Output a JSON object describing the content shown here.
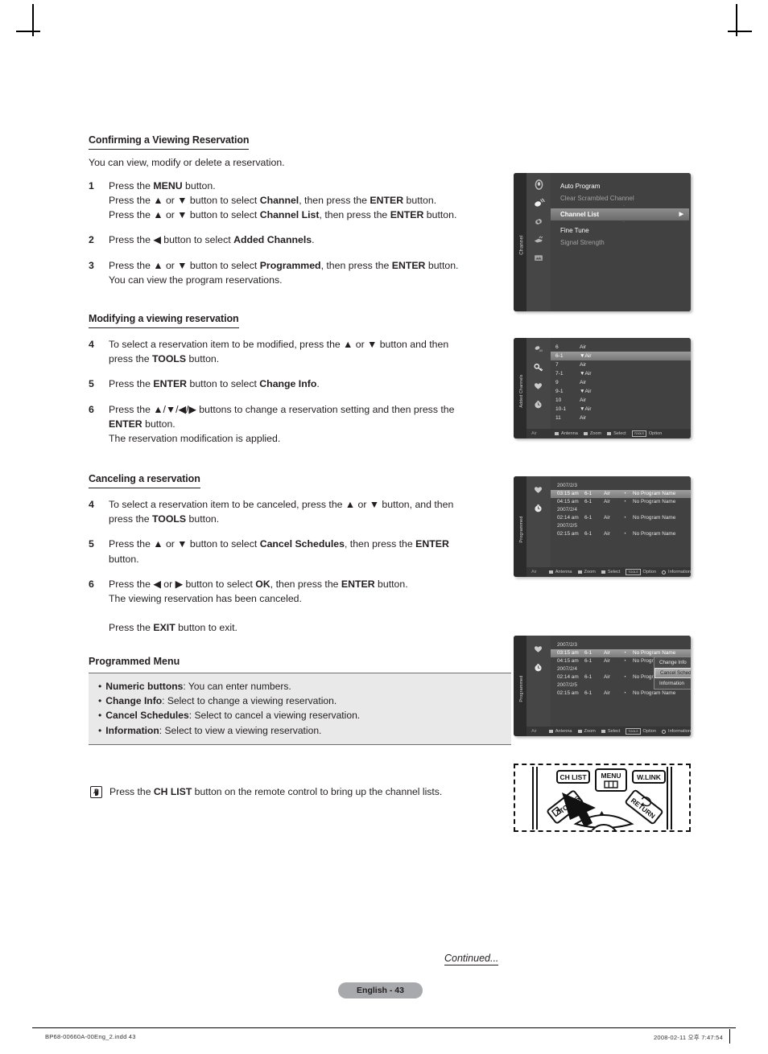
{
  "doc": {
    "page_label": "English - 43",
    "continued": "Continued...",
    "footer_left": "BP68-00660A-00Eng_2.indd   43",
    "footer_right": "2008-02-11   오후 7:47:54"
  },
  "sections": [
    {
      "heading": "Confirming a Viewing Reservation",
      "intro": "You can view, modify or delete a reservation.",
      "steps": [
        {
          "num": "1",
          "lines": [
            [
              {
                "t": "Press the "
              },
              {
                "t": "MENU",
                "b": true
              },
              {
                "t": " button."
              }
            ],
            [
              {
                "t": "Press the ▲ or ▼ button to select "
              },
              {
                "t": "Channel",
                "b": true
              },
              {
                "t": ", then press the "
              },
              {
                "t": "ENTER",
                "b": true
              },
              {
                "t": " button."
              }
            ],
            [
              {
                "t": "Press the ▲ or ▼ button to select "
              },
              {
                "t": "Channel List",
                "b": true
              },
              {
                "t": ", then press the "
              },
              {
                "t": "ENTER",
                "b": true
              },
              {
                "t": " button."
              }
            ]
          ]
        },
        {
          "num": "2",
          "lines": [
            [
              {
                "t": "Press the ◀ button to select "
              },
              {
                "t": "Added Channels",
                "b": true
              },
              {
                "t": "."
              }
            ]
          ]
        },
        {
          "num": "3",
          "lines": [
            [
              {
                "t": "Press the ▲ or ▼ button to select "
              },
              {
                "t": "Programmed",
                "b": true
              },
              {
                "t": ", then press the "
              },
              {
                "t": "ENTER",
                "b": true
              },
              {
                "t": " button."
              }
            ],
            [
              {
                "t": "You can view the program reservations."
              }
            ]
          ]
        }
      ]
    },
    {
      "heading": "Modifying a viewing reservation",
      "steps": [
        {
          "num": "4",
          "lines": [
            [
              {
                "t": "To select a reservation item to be modified, press the ▲ or ▼ button and then"
              }
            ],
            [
              {
                "t": "press the "
              },
              {
                "t": "TOOLS",
                "b": true
              },
              {
                "t": " button."
              }
            ]
          ]
        },
        {
          "num": "5",
          "lines": [
            [
              {
                "t": "Press the "
              },
              {
                "t": "ENTER",
                "b": true
              },
              {
                "t": " button to select "
              },
              {
                "t": "Change Info",
                "b": true
              },
              {
                "t": "."
              }
            ]
          ]
        },
        {
          "num": "6",
          "lines": [
            [
              {
                "t": "Press the ▲/▼/◀/▶ buttons to change a reservation setting and then press the"
              }
            ],
            [
              {
                "t": "ENTER",
                "b": true
              },
              {
                "t": " button."
              }
            ],
            [
              {
                "t": "The reservation modification is applied."
              }
            ]
          ]
        }
      ]
    },
    {
      "heading": "Canceling a reservation",
      "steps": [
        {
          "num": "4",
          "lines": [
            [
              {
                "t": "To select a reservation item to be canceled, press the ▲ or ▼ button, and then"
              }
            ],
            [
              {
                "t": "press the "
              },
              {
                "t": "TOOLS",
                "b": true
              },
              {
                "t": " button."
              }
            ]
          ]
        },
        {
          "num": "5",
          "lines": [
            [
              {
                "t": "Press the ▲ or ▼ button to select "
              },
              {
                "t": "Cancel Schedules",
                "b": true
              },
              {
                "t": ", then press the "
              },
              {
                "t": "ENTER",
                "b": true
              }
            ],
            [
              {
                "t": "button."
              }
            ]
          ]
        },
        {
          "num": "6",
          "lines": [
            [
              {
                "t": "Press the ◀ or ▶ button to select "
              },
              {
                "t": "OK",
                "b": true
              },
              {
                "t": ", then press the "
              },
              {
                "t": "ENTER",
                "b": true
              },
              {
                "t": " button."
              }
            ],
            [
              {
                "t": "The viewing reservation has been canceled."
              }
            ],
            [
              {
                "t": ""
              }
            ],
            [
              {
                "t": "Press the "
              },
              {
                "t": "EXIT",
                "b": true
              },
              {
                "t": " button to exit."
              }
            ]
          ]
        }
      ]
    }
  ],
  "programmed_menu": {
    "heading": "Programmed Menu",
    "bullets": [
      {
        "term": "Numeric buttons",
        "desc": ": You can enter numbers."
      },
      {
        "term": "Change Info",
        "desc": ": Select to change a viewing reservation."
      },
      {
        "term": "Cancel Schedules",
        "desc": ": Select to cancel a viewing reservation."
      },
      {
        "term": "Information",
        "desc": ": Select to view a viewing reservation."
      }
    ]
  },
  "note": {
    "icon": "hand-pointer-icon",
    "parts": [
      {
        "t": "Press the "
      },
      {
        "t": "CH LIST",
        "b": true
      },
      {
        "t": " button on the remote control to bring up the channel lists."
      }
    ]
  },
  "osd": {
    "menu_channel": {
      "tab_label": "Channel",
      "icons": [
        "picture-icon",
        "sound-antenna-icon",
        "setup-gear-icon",
        "input-plug-icon",
        "pc-screen-icon"
      ],
      "selected_icon_index": 1,
      "items": [
        {
          "label": "Auto Program",
          "state": "normal"
        },
        {
          "label": "Clear Scrambled Channel",
          "state": "dim"
        },
        {
          "label": "Channel List",
          "state": "highlight",
          "arrow": "▶"
        },
        {
          "label": "Fine Tune",
          "state": "normal"
        },
        {
          "label": "Signal Strength",
          "state": "dim"
        }
      ]
    },
    "added_channels": {
      "tab_label": "Added Channels",
      "icons": [
        "antenna-all-icon",
        "key-icon",
        "heart-icon",
        "clock-icon"
      ],
      "selected_icon_index": 1,
      "columns": [
        "channel",
        "source"
      ],
      "rows": [
        {
          "channel": "6",
          "source": "Air",
          "marker": "",
          "highlight": false
        },
        {
          "channel": "6-1",
          "source": "Air",
          "marker": "▼",
          "highlight": true
        },
        {
          "channel": "7",
          "source": "Air",
          "marker": "",
          "highlight": false
        },
        {
          "channel": "7-1",
          "source": "Air",
          "marker": "▼",
          "highlight": false
        },
        {
          "channel": "9",
          "source": "Air",
          "marker": "",
          "highlight": false
        },
        {
          "channel": "9-1",
          "source": "Air",
          "marker": "▼",
          "highlight": false
        },
        {
          "channel": "10",
          "source": "Air",
          "marker": "",
          "highlight": false
        },
        {
          "channel": "10-1",
          "source": "Air",
          "marker": "▼",
          "highlight": false
        },
        {
          "channel": "11",
          "source": "Air",
          "marker": "",
          "highlight": false
        }
      ],
      "statusbar": {
        "antenna_mode": "Air",
        "keys": [
          "Antenna",
          "Zoom",
          "Select"
        ],
        "tools_key": "TOOLS",
        "tools_label": "Option"
      }
    },
    "programmed": {
      "tab_label": "Programmed",
      "icons": [
        "heart-icon",
        "clock-icon"
      ],
      "selected_icon_index": 1,
      "rows": [
        {
          "type": "date",
          "date": "2007/2/3"
        },
        {
          "type": "entry",
          "time": "03:15   am",
          "channel": "6-1",
          "source": "Air",
          "clock": "◔",
          "name": "No Program Name",
          "highlight": true
        },
        {
          "type": "entry",
          "time": "04:15   am",
          "channel": "6-1",
          "source": "Air",
          "clock": "◔",
          "name": "No Program Name",
          "highlight": false
        },
        {
          "type": "date",
          "date": "2007/2/4"
        },
        {
          "type": "entry",
          "time": "02:14   am",
          "channel": "6-1",
          "source": "Air",
          "clock": "◔",
          "name": "No Program Name",
          "highlight": false
        },
        {
          "type": "date",
          "date": "2007/2/5"
        },
        {
          "type": "entry",
          "time": "02:15   am",
          "channel": "6-1",
          "source": "Air",
          "clock": "◔",
          "name": "No Program Name",
          "highlight": false
        }
      ],
      "statusbar": {
        "antenna_mode": "Air",
        "keys": [
          "Antenna",
          "Zoom",
          "Select"
        ],
        "tools_key": "TOOLS",
        "tools_label": "Option",
        "info_label": "Information"
      }
    },
    "programmed_with_popup": {
      "tab_label": "Programmed",
      "popup_items": [
        {
          "label": "Change Info",
          "selected": false
        },
        {
          "label": "Cancel Schedules",
          "selected": true
        },
        {
          "label": "Information",
          "selected": false
        }
      ]
    }
  },
  "remote": {
    "buttons": [
      {
        "label": "CH LIST",
        "name": "ch-list-button"
      },
      {
        "label": "MENU",
        "name": "menu-button"
      },
      {
        "label": "W.LINK",
        "name": "wlink-button"
      },
      {
        "label": "TOOLS",
        "name": "tools-button"
      },
      {
        "label": "RETURN",
        "name": "return-button"
      }
    ]
  }
}
